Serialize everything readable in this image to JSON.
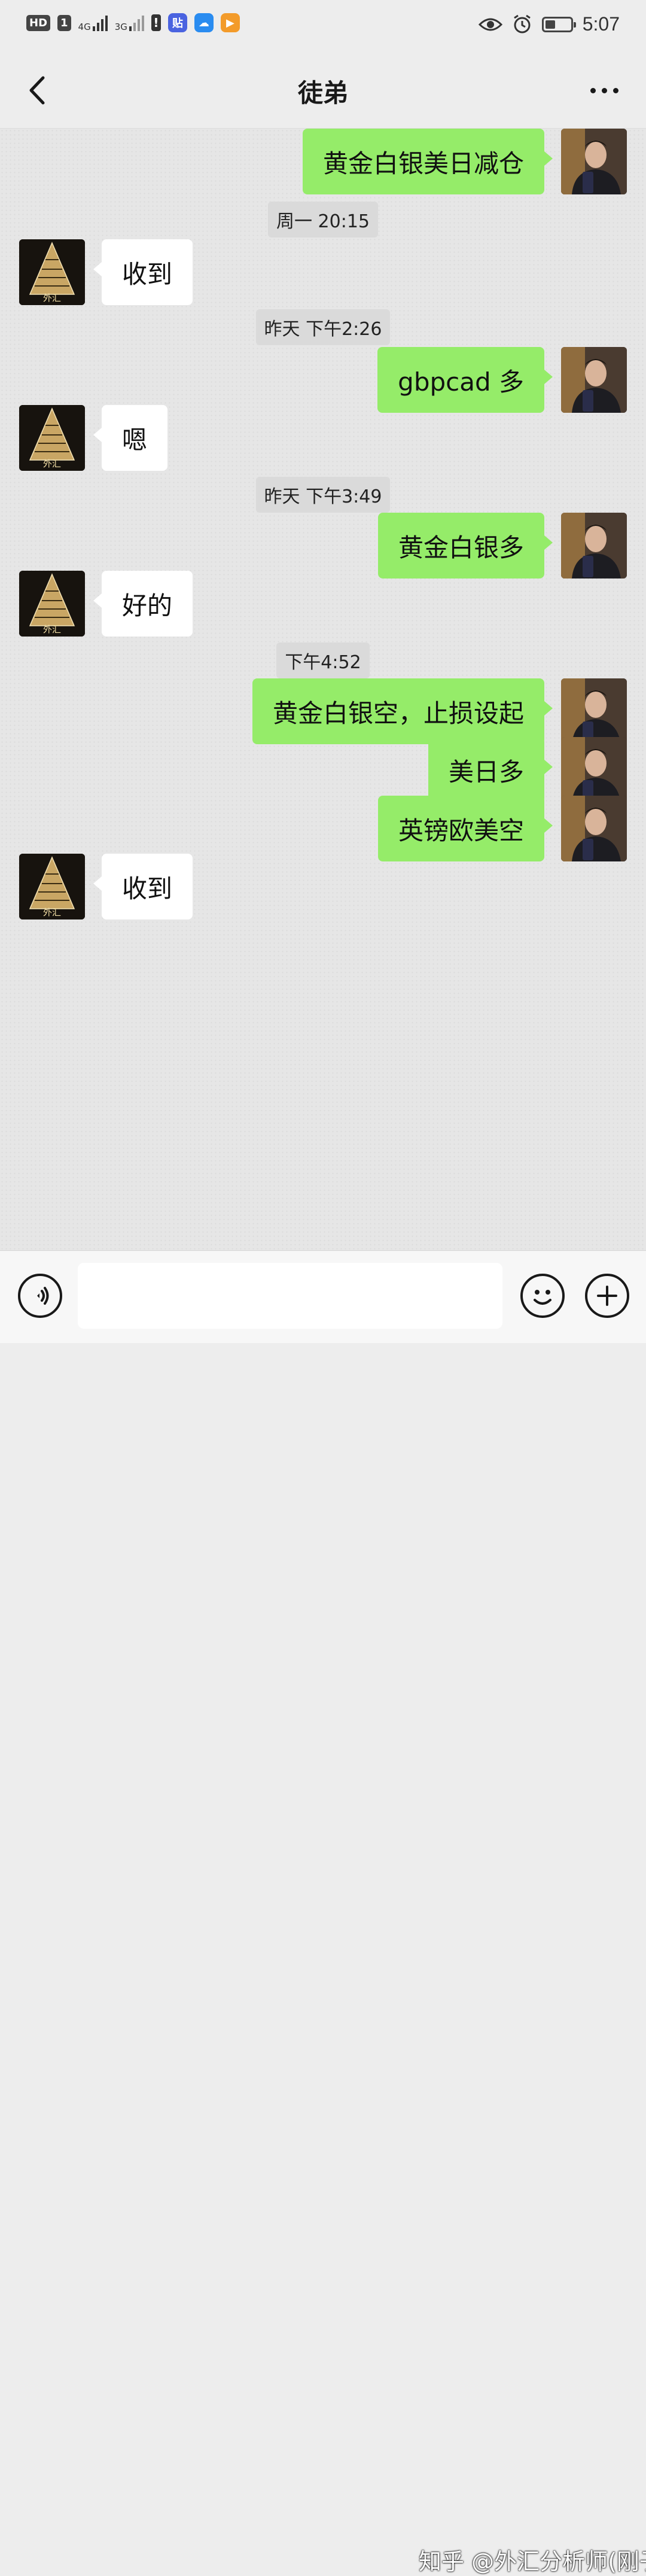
{
  "status_bar": {
    "hd_badge": "HD",
    "sim_badge": "1",
    "network_1": "4G",
    "network_2": "3G",
    "time": "5:07",
    "icons": [
      "signal-icon",
      "alert-icon",
      "tieba-app-icon",
      "cloud-app-icon",
      "video-app-icon",
      "eye-icon",
      "alarm-icon",
      "battery-icon"
    ]
  },
  "header": {
    "title": "徒弟",
    "back_icon": "chevron-left-icon",
    "more_icon": "more-dots-icon"
  },
  "messages": [
    {
      "type": "msg",
      "sender": "me",
      "text": "黄金白银美日减仓"
    },
    {
      "type": "time",
      "text": "周一 20:15"
    },
    {
      "type": "msg",
      "sender": "them",
      "text": "收到"
    },
    {
      "type": "time",
      "text": "昨天 下午2:26"
    },
    {
      "type": "msg",
      "sender": "me",
      "text": "gbpcad 多"
    },
    {
      "type": "msg",
      "sender": "them",
      "text": "嗯"
    },
    {
      "type": "time",
      "text": "昨天 下午3:49"
    },
    {
      "type": "msg",
      "sender": "me",
      "text": "黄金白银多"
    },
    {
      "type": "msg",
      "sender": "them",
      "text": "好的"
    },
    {
      "type": "time",
      "text": "下午4:52"
    },
    {
      "type": "msg",
      "sender": "me",
      "text": "黄金白银空，止损设起"
    },
    {
      "type": "msg",
      "sender": "me",
      "text": "美日多"
    },
    {
      "type": "msg",
      "sender": "me",
      "text": "英镑欧美空"
    },
    {
      "type": "msg",
      "sender": "them",
      "text": "收到"
    }
  ],
  "contact_avatar_label": "外汇",
  "input_bar": {
    "voice_icon": "voice-icon",
    "emoji_icon": "emoji-icon",
    "plus_icon": "plus-icon",
    "value": ""
  },
  "watermark": "知乎 @外汇分析师(刚子)",
  "colors": {
    "my_bubble": "#95ec69",
    "their_bubble": "#ffffff",
    "background": "#ededed"
  }
}
